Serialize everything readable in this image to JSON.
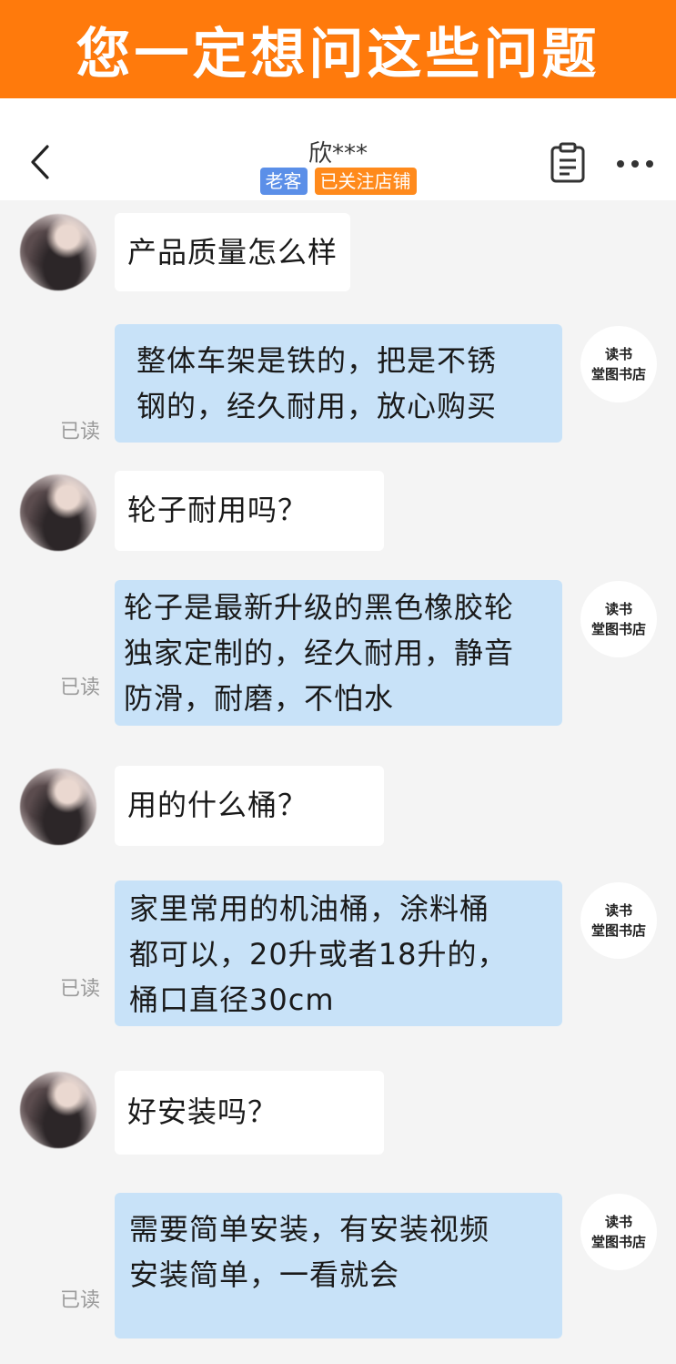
{
  "banner": {
    "title": "您一定想问这些问题"
  },
  "header": {
    "title": "欣***",
    "badges": [
      "老客",
      "已关注店铺"
    ]
  },
  "shop": {
    "avatar_line1": "读书",
    "avatar_line2": "堂图书店"
  },
  "messages": [
    {
      "from": "customer",
      "text": "产品质量怎么样"
    },
    {
      "from": "shop",
      "lines": [
        "整体车架是铁的，把是不锈",
        "钢的，经久耐用，放心购买"
      ],
      "status": "已读"
    },
    {
      "from": "customer",
      "text": "轮子耐用吗？"
    },
    {
      "from": "shop",
      "lines": [
        "轮子是最新升级的黑色橡胶轮",
        "独家定制的，经久耐用，静音",
        "防滑，耐磨，不怕水"
      ],
      "status": "已读"
    },
    {
      "from": "customer",
      "text": "用的什么桶？"
    },
    {
      "from": "shop",
      "lines": [
        "家里常用的机油桶，涂料桶",
        "都可以，20升或者18升的，",
        "桶口直径30cm"
      ],
      "status": "已读"
    },
    {
      "from": "customer",
      "text": "好安装吗？"
    },
    {
      "from": "shop",
      "lines": [
        "需要简单安装，有安装视频",
        "安装简单，一看就会"
      ],
      "status": "已读"
    }
  ]
}
